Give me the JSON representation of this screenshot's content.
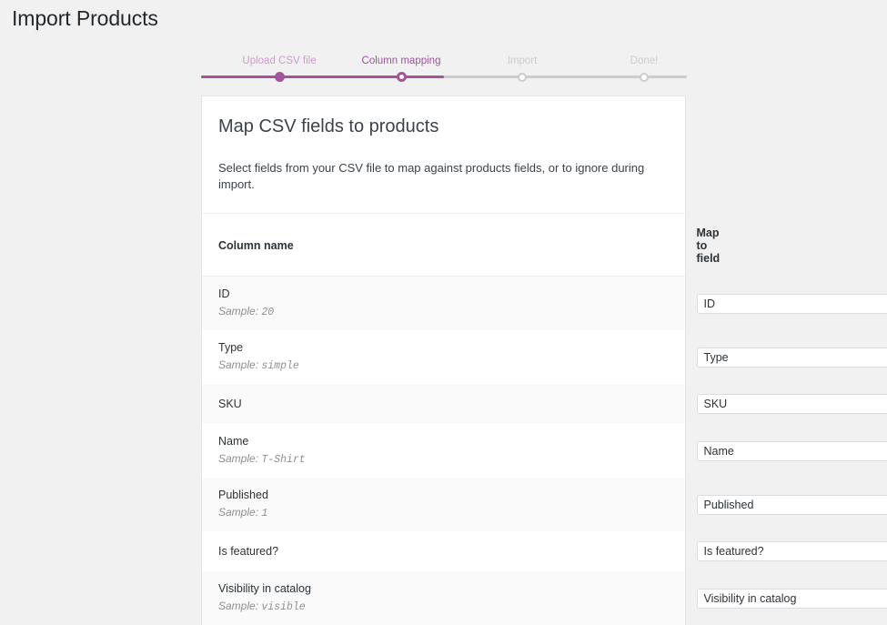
{
  "page": {
    "title": "Import Products"
  },
  "stepper": {
    "steps": [
      {
        "label": "Upload CSV file",
        "state": "done"
      },
      {
        "label": "Column mapping",
        "state": "active"
      },
      {
        "label": "Import",
        "state": "todo"
      },
      {
        "label": "Done!",
        "state": "todo"
      }
    ],
    "accent_color": "#a1559d",
    "inactive_color": "#cccccc",
    "done_label_color": "#cf9bcc"
  },
  "card": {
    "title": "Map CSV fields to products",
    "subtitle": "Select fields from your CSV file to map against products fields, or to ignore during import.",
    "columns": {
      "name_header": "Column name",
      "map_header": "Map to field"
    },
    "sample_prefix": "Sample:",
    "rows": [
      {
        "name": "ID",
        "sample": "20",
        "mapped": "ID"
      },
      {
        "name": "Type",
        "sample": "simple",
        "mapped": "Type"
      },
      {
        "name": "SKU",
        "sample": "",
        "mapped": "SKU"
      },
      {
        "name": "Name",
        "sample": "T-Shirt",
        "mapped": "Name"
      },
      {
        "name": "Published",
        "sample": "1",
        "mapped": "Published"
      },
      {
        "name": "Is featured?",
        "sample": "",
        "mapped": "Is featured?"
      },
      {
        "name": "Visibility in catalog",
        "sample": "visible",
        "mapped": "Visibility in catalog"
      }
    ]
  }
}
